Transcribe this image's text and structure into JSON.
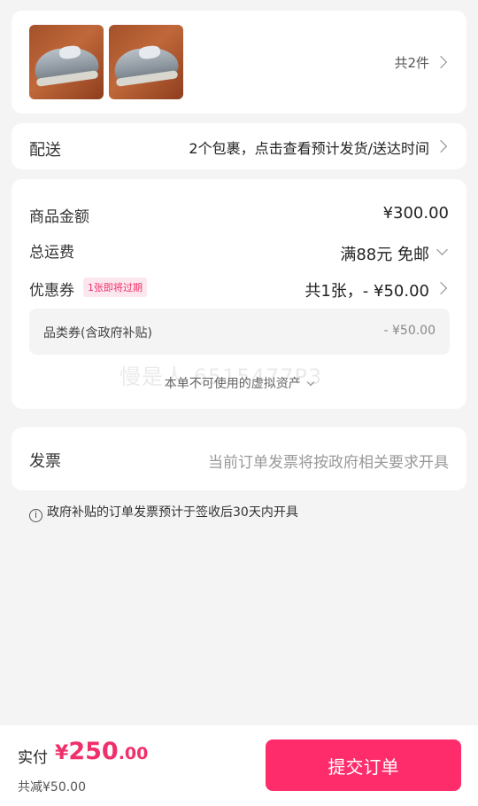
{
  "products": {
    "thumbnails": [
      "shoe-image",
      "shoe-image"
    ],
    "count_label": "共2件"
  },
  "delivery": {
    "label": "配送",
    "value": "2个包裹，点击查看预计发货/送达时间"
  },
  "amounts": {
    "goods_label": "商品金额",
    "goods_value": "¥300.00",
    "shipping_label": "总运费",
    "shipping_value": "满88元 免邮",
    "coupon_label": "优惠券",
    "coupon_badge": "1张即将过期",
    "coupon_value": "共1张，- ¥50.00",
    "category_coupon_label": "品类券(含政府补贴)",
    "category_coupon_value": "- ¥50.00",
    "virtual_assets_text": "本单不可使用的虚拟资产",
    "watermark_text": "慢是人 6515477P3"
  },
  "invoice": {
    "label": "发票",
    "value": "当前订单发票将按政府相关要求开具"
  },
  "note": {
    "icon": "info-icon",
    "text": "政府补贴的订单发票预计于签收后30天内开具"
  },
  "bottom": {
    "pay_label": "实付",
    "currency": "¥",
    "amount_int": "250",
    "amount_dec": ".00",
    "discount_text": "共减¥50.00",
    "submit_label": "提交订单"
  },
  "colors": {
    "accent": "#fe2c6b",
    "price": "#f0306a",
    "background": "#f4f4f5"
  }
}
